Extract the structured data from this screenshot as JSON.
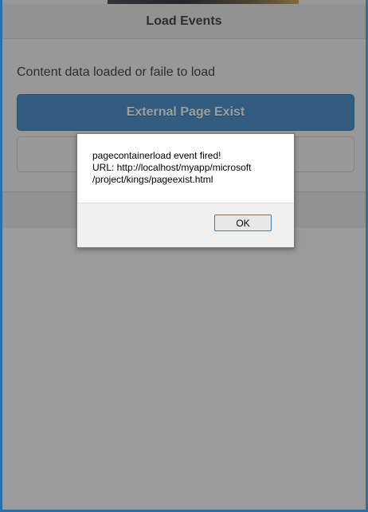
{
  "header": {
    "title": "Load Events"
  },
  "content": {
    "message": "Content data loaded or faile to load",
    "primary_button": "External Page Exist",
    "secondary_button": ""
  },
  "dialog": {
    "line1": "pagecontainerload event fired!",
    "line2": "URL: http://localhost/myapp/microsoft",
    "line3": "/project/kings/pageexist.html",
    "ok_label": "OK"
  },
  "colors": {
    "window_border": "#2a6fa8",
    "primary_button": "#3b88c8",
    "ok_button_border": "#3c7fb1"
  }
}
